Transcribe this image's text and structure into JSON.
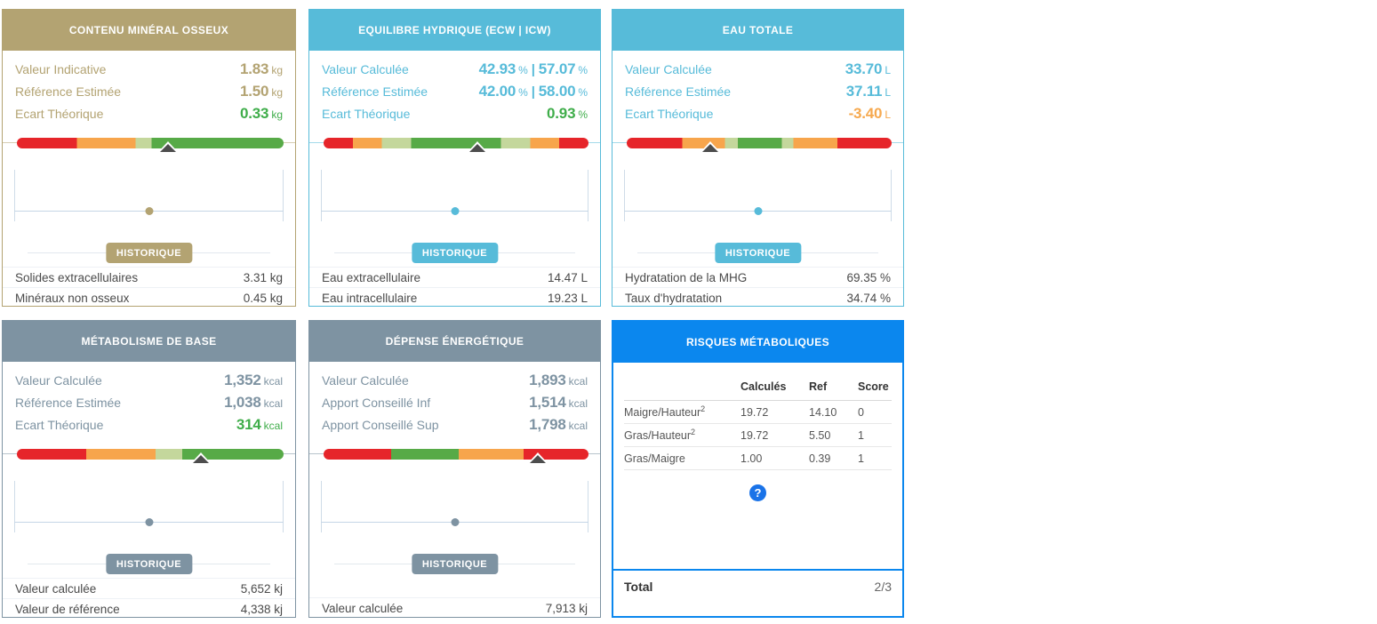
{
  "historique_label": "HISTORIQUE",
  "colors": {
    "tan": "#b3a372",
    "aqua": "#57bbd9",
    "slate": "#7e93a2",
    "blue": "#0b87ee",
    "positive_green": "#3fad4a",
    "negative_orange": "#f6a94f",
    "bar_red": "#e6252a",
    "bar_orange": "#f7a54c",
    "bar_lightgreen": "#c4d79c",
    "bar_green": "#57aa47",
    "marker_gray": "#4d4d4d"
  },
  "cards": [
    {
      "title": "CONTENU MINÉRAL OSSEUX",
      "accent": "#b3a372",
      "stats": [
        {
          "label": "Valeur Indicative",
          "num": "1.83",
          "unit": "kg",
          "value_color": "#b3a372"
        },
        {
          "label": "Référence Estimée",
          "num": "1.50",
          "unit": "kg",
          "value_color": "#b3a372"
        },
        {
          "label": "Ecart Théorique",
          "num": "0.33",
          "unit": "kg",
          "value_color": "#3fad4a"
        }
      ],
      "gauge": {
        "segments": [
          {
            "color": "#e6252a",
            "to": 22.5
          },
          {
            "color": "#f7a54c",
            "to": 44.5
          },
          {
            "color": "#c4d79c",
            "to": 50.5
          },
          {
            "color": "#57aa47",
            "to": 100
          }
        ],
        "marker_pct": 56.5
      },
      "dot_pct": 50,
      "footer": [
        {
          "label": "Solides extracellulaires",
          "value": "3.31 kg"
        },
        {
          "label": "Minéraux non osseux",
          "value": "0.45 kg"
        }
      ]
    },
    {
      "title": "EQUILIBRE HYDRIQUE (ECW | ICW)",
      "accent": "#57bbd9",
      "stats": [
        {
          "label": "Valeur Calculée",
          "num": "42.93",
          "unit": "%",
          "sep": "|",
          "num2": "57.07",
          "unit2": "%",
          "value_color": "#57bbd9"
        },
        {
          "label": "Référence Estimée",
          "num": "42.00",
          "unit": "%",
          "sep": "|",
          "num2": "58.00",
          "unit2": "%",
          "value_color": "#57bbd9"
        },
        {
          "label": "Ecart Théorique",
          "num": "0.93",
          "unit": "%",
          "value_color": "#3fad4a"
        }
      ],
      "gauge": {
        "segments": [
          {
            "color": "#e6252a",
            "to": 11
          },
          {
            "color": "#f7a54c",
            "to": 22
          },
          {
            "color": "#c4d79c",
            "to": 33
          },
          {
            "color": "#57aa47",
            "to": 67
          },
          {
            "color": "#c4d79c",
            "to": 78
          },
          {
            "color": "#f7a54c",
            "to": 89
          },
          {
            "color": "#e6252a",
            "to": 100
          }
        ],
        "marker_pct": 58
      },
      "dot_pct": 50,
      "footer": [
        {
          "label": "Eau extracellulaire",
          "value": "14.47 L"
        },
        {
          "label": "Eau intracellulaire",
          "value": "19.23 L"
        }
      ]
    },
    {
      "title": "EAU TOTALE",
      "accent": "#57bbd9",
      "stats": [
        {
          "label": "Valeur Calculée",
          "num": "33.70",
          "unit": "L",
          "value_color": "#57bbd9"
        },
        {
          "label": "Référence Estimée",
          "num": "37.11",
          "unit": "L",
          "value_color": "#57bbd9"
        },
        {
          "label": "Ecart Théorique",
          "num": "-3.40",
          "unit": "L",
          "value_color": "#f6a94f"
        }
      ],
      "gauge": {
        "segments": [
          {
            "color": "#e6252a",
            "to": 21
          },
          {
            "color": "#f7a54c",
            "to": 37
          },
          {
            "color": "#c4d79c",
            "to": 42
          },
          {
            "color": "#57aa47",
            "to": 58.5
          },
          {
            "color": "#c4d79c",
            "to": 63
          },
          {
            "color": "#f7a54c",
            "to": 79.5
          },
          {
            "color": "#e6252a",
            "to": 100
          }
        ],
        "marker_pct": 31.5
      },
      "dot_pct": 50,
      "footer": [
        {
          "label": "Hydratation de la MHG",
          "value": "69.35 %"
        },
        {
          "label": "Taux d'hydratation",
          "value": "34.74 %"
        }
      ]
    },
    {
      "title": "MÉTABOLISME DE BASE",
      "accent": "#7e93a2",
      "stats": [
        {
          "label": "Valeur Calculée",
          "num": "1,352",
          "unit": "kcal",
          "value_color": "#7e93a2"
        },
        {
          "label": "Référence Estimée",
          "num": "1,038",
          "unit": "kcal",
          "value_color": "#7e93a2"
        },
        {
          "label": "Ecart Théorique",
          "num": "314",
          "unit": "kcal",
          "value_color": "#3fad4a"
        }
      ],
      "gauge": {
        "segments": [
          {
            "color": "#e6252a",
            "to": 26
          },
          {
            "color": "#f7a54c",
            "to": 52
          },
          {
            "color": "#c4d79c",
            "to": 62
          },
          {
            "color": "#57aa47",
            "to": 100
          }
        ],
        "marker_pct": 69
      },
      "dot_pct": 50,
      "footer": [
        {
          "label": "Valeur calculée",
          "value": "5,652 kj"
        },
        {
          "label": "Valeur de référence",
          "value": "4,338 kj"
        }
      ]
    },
    {
      "title": "DÉPENSE ÉNERGÉTIQUE",
      "accent": "#7e93a2",
      "stats": [
        {
          "label": "Valeur Calculée",
          "num": "1,893",
          "unit": "kcal",
          "value_color": "#7e93a2"
        },
        {
          "label": "Apport Conseillé Inf",
          "num": "1,514",
          "unit": "kcal",
          "value_color": "#7e93a2"
        },
        {
          "label": "Apport Conseillé Sup",
          "num": "1,798",
          "unit": "kcal",
          "value_color": "#7e93a2"
        }
      ],
      "gauge": {
        "segments": [
          {
            "color": "#e6252a",
            "to": 25.5
          },
          {
            "color": "#57aa47",
            "to": 51
          },
          {
            "color": "#f7a54c",
            "to": 75.5
          },
          {
            "color": "#e6252a",
            "to": 100
          }
        ],
        "marker_pct": 81
      },
      "dot_pct": 50,
      "footer": [
        {
          "label": "Valeur calculée",
          "value": "7,913 kj"
        }
      ]
    }
  ],
  "risk_card": {
    "title": "RISQUES MÉTABOLIQUES",
    "accent": "#0b87ee",
    "columns": [
      "Calculés",
      "Ref",
      "Score"
    ],
    "rows": [
      {
        "label": "Maigre/Hauteur",
        "sup": "2",
        "calc": "19.72",
        "ref": "14.10",
        "score": "0"
      },
      {
        "label": "Gras/Hauteur",
        "sup": "2",
        "calc": "19.72",
        "ref": "5.50",
        "score": "1"
      },
      {
        "label": "Gras/Maigre",
        "calc": "1.00",
        "ref": "0.39",
        "score": "1"
      }
    ],
    "help_glyph": "?",
    "total_label": "Total",
    "total_value": "2/3"
  }
}
